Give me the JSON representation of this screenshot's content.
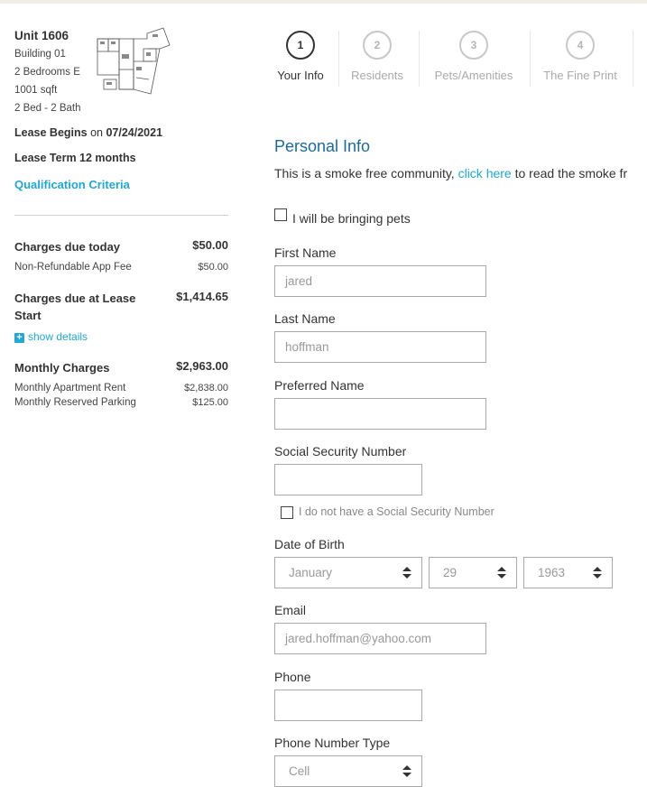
{
  "summary": {
    "unit": "Unit 1606",
    "building": "Building 01",
    "floorplan": "2 Bedrooms E",
    "sqft": "1001 sqft",
    "beds_baths": "2 Bed - 2 Bath",
    "lease_begins_label": "Lease Begins",
    "lease_begins_on": "on",
    "lease_begins_date": "07/24/2021",
    "lease_term": "Lease Term 12 months",
    "qualification_link": "Qualification Criteria"
  },
  "charges": {
    "due_today": {
      "label": "Charges due today",
      "amount": "$50.00"
    },
    "app_fee": {
      "label": "Non-Refundable App Fee",
      "amount": "$50.00"
    },
    "due_lease_start": {
      "label": "Charges due at Lease Start",
      "amount": "$1,414.65"
    },
    "show_details": "show details",
    "monthly": {
      "label": "Monthly Charges",
      "amount": "$2,963.00"
    },
    "rent": {
      "label": "Monthly Apartment Rent",
      "amount": "$2,838.00"
    },
    "parking": {
      "label": "Monthly Reserved Parking",
      "amount": "$125.00"
    }
  },
  "steps": [
    {
      "num": "1",
      "label": "Your Info"
    },
    {
      "num": "2",
      "label": "Residents"
    },
    {
      "num": "3",
      "label": "Pets/Amenities"
    },
    {
      "num": "4",
      "label": "The Fine Print"
    }
  ],
  "form": {
    "section_title": "Personal Info",
    "smoke_text": "This is a smoke free community, ",
    "smoke_link": "click here",
    "smoke_text_after": " to read the smoke fr",
    "pets_checkbox": "I will be bringing pets",
    "first_name": {
      "label": "First Name",
      "value": "jared"
    },
    "last_name": {
      "label": "Last Name",
      "value": "hoffman"
    },
    "preferred_name": {
      "label": "Preferred Name",
      "value": ""
    },
    "ssn": {
      "label": "Social Security Number",
      "value": ""
    },
    "no_ssn_checkbox": "I do not have a Social Security Number",
    "dob": {
      "label": "Date of Birth",
      "month": "January",
      "day": "29",
      "year": "1963"
    },
    "email": {
      "label": "Email",
      "value": "jared.hoffman@yahoo.com"
    },
    "phone": {
      "label": "Phone",
      "value": ""
    },
    "phone_type": {
      "label": "Phone Number Type",
      "value": "Cell"
    }
  },
  "icons": {
    "plus": "plus-icon",
    "select_arrows": "updown-arrows-icon",
    "floorplan": "floorplan-image"
  },
  "colors": {
    "accent": "#1ea9d6",
    "title": "#1b6b9a"
  }
}
